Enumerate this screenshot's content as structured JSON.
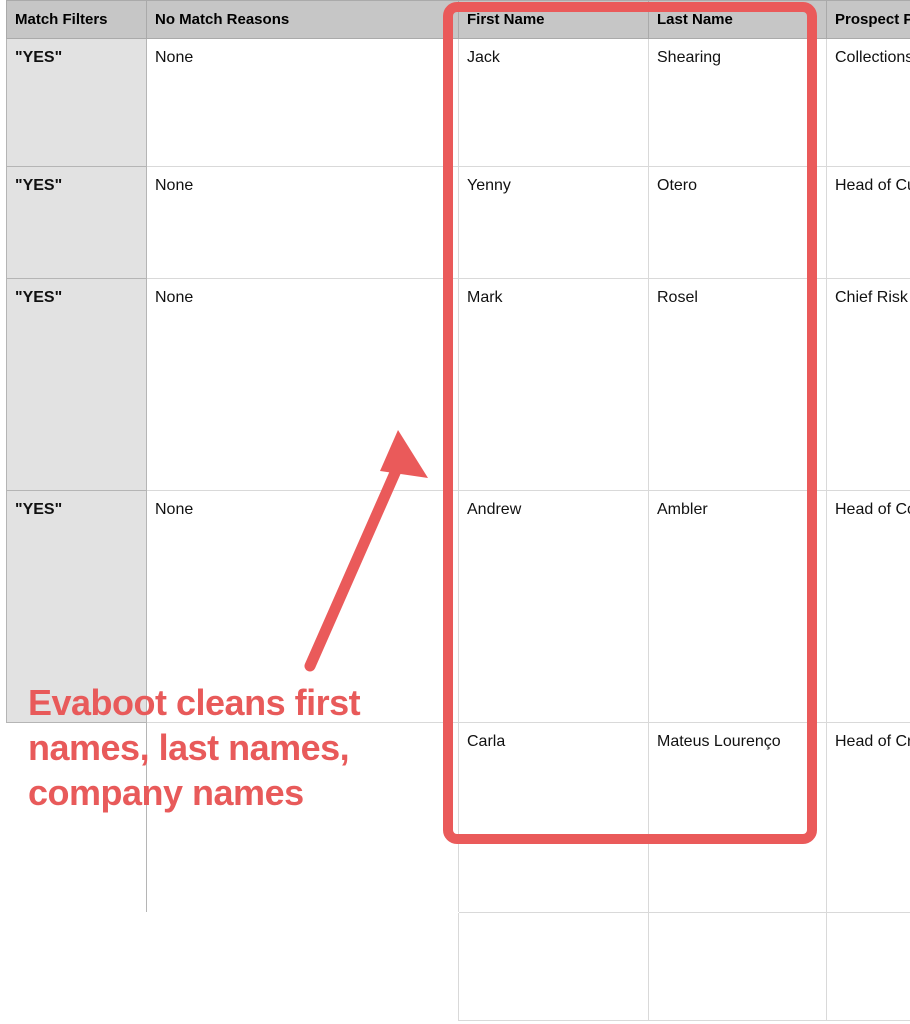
{
  "table": {
    "headers": {
      "match": "Match Filters",
      "reason": "No Match Reasons",
      "first": "First Name",
      "last": "Last Name",
      "prospect": "Prospect P"
    },
    "rows": [
      {
        "match": "\"YES\"",
        "reason": "None",
        "first": "Jack",
        "last": "Shearing",
        "prospect": "Collections"
      },
      {
        "match": "\"YES\"",
        "reason": "None",
        "first": "Yenny",
        "last": "Otero",
        "prospect": "Head of Cus"
      },
      {
        "match": "\"YES\"",
        "reason": "None",
        "first": "Mark",
        "last": "Rosel",
        "prospect": "Chief Risk O"
      },
      {
        "match": "\"YES\"",
        "reason": "None",
        "first": "Andrew",
        "last": "Ambler",
        "prospect": "Head of Co"
      },
      {
        "match": "",
        "reason": "",
        "first": "Carla",
        "last": "Mateus Lourenço",
        "prospect": "Head of Cre"
      },
      {
        "match": "",
        "reason": "",
        "first": "",
        "last": "",
        "prospect": ""
      }
    ]
  },
  "annotation": "Evaboot cleans first names, last names, company names",
  "colors": {
    "highlight": "#ea5a5a"
  }
}
